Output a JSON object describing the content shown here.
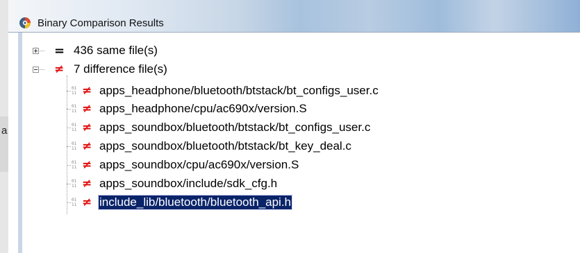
{
  "window": {
    "title": "Binary Comparison Results"
  },
  "background": {
    "glyph": "a"
  },
  "tree": {
    "groups": [
      {
        "expander": "plus",
        "status_icon": "equal-icon",
        "status_glyph": "=",
        "label": "436 same file(s)"
      },
      {
        "expander": "minus",
        "status_icon": "not-equal-icon",
        "status_glyph": "≠",
        "label": "7 difference file(s)"
      }
    ],
    "files": [
      {
        "label": "apps_headphone/bluetooth/btstack/bt_configs_user.c",
        "selected": false
      },
      {
        "label": "apps_headphone/cpu/ac690x/version.S",
        "selected": false
      },
      {
        "label": "apps_soundbox/bluetooth/btstack/bt_configs_user.c",
        "selected": false
      },
      {
        "label": "apps_soundbox/bluetooth/btstack/bt_key_deal.c",
        "selected": false
      },
      {
        "label": "apps_soundbox/cpu/ac690x/version.S",
        "selected": false
      },
      {
        "label": "apps_soundbox/include/sdk_cfg.h",
        "selected": false
      },
      {
        "label": "include_lib/bluetooth/bluetooth_api.h",
        "selected": true
      }
    ],
    "file_status_glyph": "≠",
    "binary_icon_glyph": "01\n11"
  },
  "colors": {
    "equal": "#000000",
    "difference": "#e01010",
    "selection": "#0a246a"
  }
}
